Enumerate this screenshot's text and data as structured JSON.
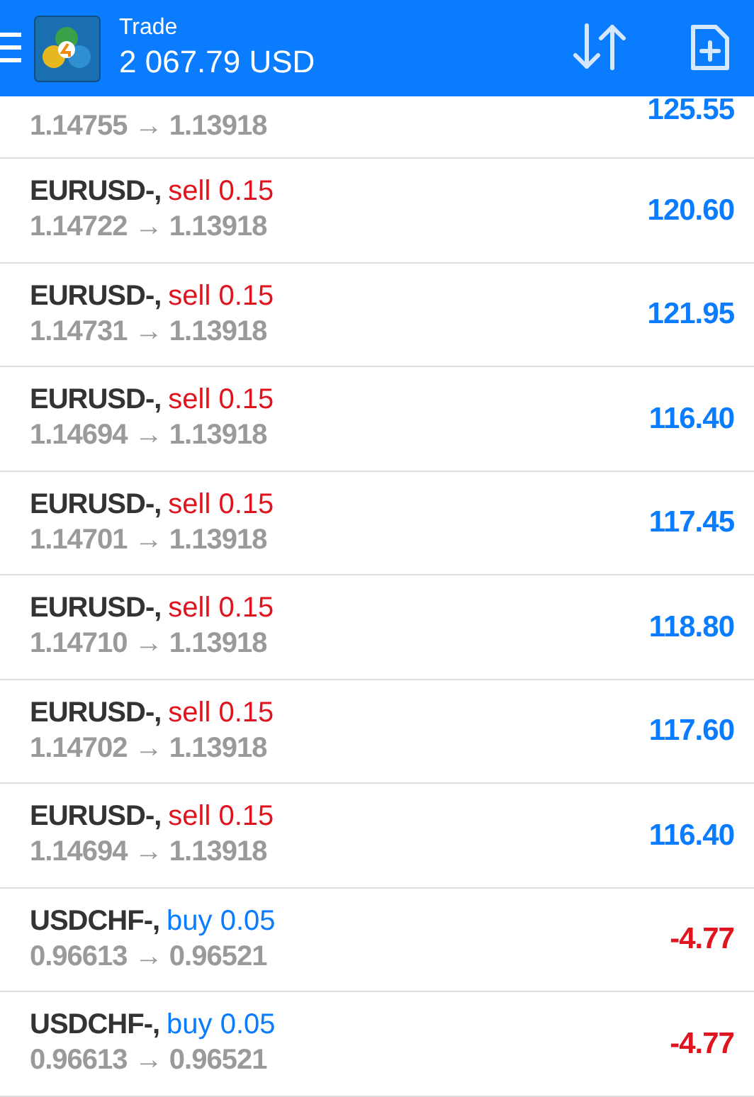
{
  "header": {
    "title": "Trade",
    "balance": "2 067.79 USD"
  },
  "positions": [
    {
      "prices": "1.14755 → 1.13918",
      "profit": "125.55",
      "color": "#0a7cff"
    },
    {
      "symbol": "EURUSD-,",
      "kind": "sell",
      "order": "sell 0.15",
      "prices": "1.14722 → 1.13918",
      "profit": "120.60",
      "color": "#0a7cff"
    },
    {
      "symbol": "EURUSD-,",
      "kind": "sell",
      "order": "sell 0.15",
      "prices": "1.14731 → 1.13918",
      "profit": "121.95",
      "color": "#0a7cff"
    },
    {
      "symbol": "EURUSD-,",
      "kind": "sell",
      "order": "sell 0.15",
      "prices": "1.14694 → 1.13918",
      "profit": "116.40",
      "color": "#0a7cff"
    },
    {
      "symbol": "EURUSD-,",
      "kind": "sell",
      "order": "sell 0.15",
      "prices": "1.14701 → 1.13918",
      "profit": "117.45",
      "color": "#0a7cff"
    },
    {
      "symbol": "EURUSD-,",
      "kind": "sell",
      "order": "sell 0.15",
      "prices": "1.14710 → 1.13918",
      "profit": "118.80",
      "color": "#0a7cff"
    },
    {
      "symbol": "EURUSD-,",
      "kind": "sell",
      "order": "sell 0.15",
      "prices": "1.14702 → 1.13918",
      "profit": "117.60",
      "color": "#0a7cff"
    },
    {
      "symbol": "EURUSD-,",
      "kind": "sell",
      "order": "sell 0.15",
      "prices": "1.14694 → 1.13918",
      "profit": "116.40",
      "color": "#0a7cff"
    },
    {
      "symbol": "USDCHF-,",
      "kind": "buy",
      "order": "buy 0.05",
      "prices": "0.96613 → 0.96521",
      "profit": "-4.77",
      "color": "#e0141e"
    },
    {
      "symbol": "USDCHF-,",
      "kind": "buy",
      "order": "buy 0.05",
      "prices": "0.96613 → 0.96521",
      "profit": "-4.77",
      "color": "#e0141e"
    }
  ]
}
